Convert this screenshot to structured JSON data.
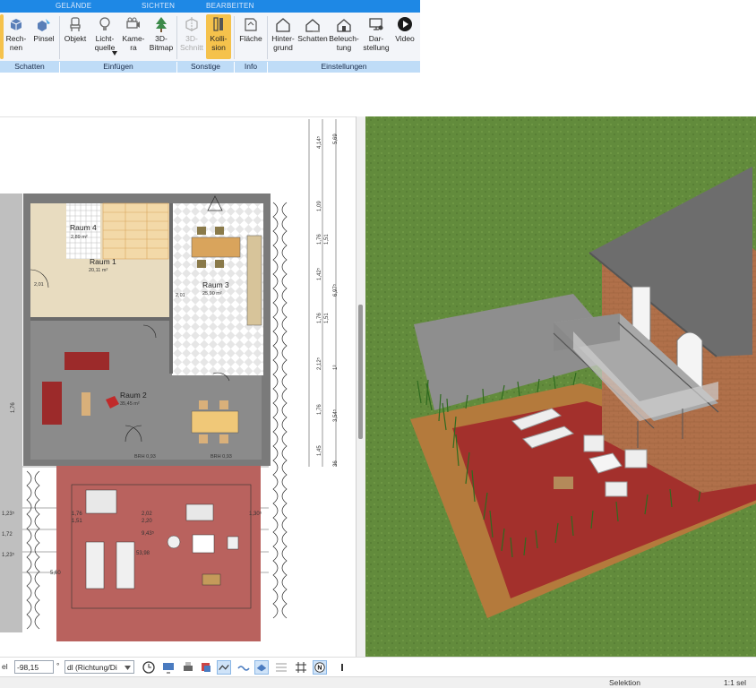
{
  "ribbon": {
    "tabs": [
      "GELÄNDE",
      "SICHTEN",
      "BEARBEITEN"
    ],
    "buttons": {
      "rechnen": "Rech-\nnen",
      "pinsel": "Pinsel",
      "objekt": "Objekt",
      "lichtquelle": "Licht-\nquelle",
      "kamera": "Kame-\nra",
      "bitmap": "3D-\nBitmap",
      "schnitt": "3D-\nSchnitt",
      "kollision": "Kolli-\nsion",
      "flaeche": "Fläche",
      "hintergrund": "Hinter-\ngrund",
      "schatten": "Schatten",
      "beleuchtung": "Beleuch-\ntung",
      "darstellung": "Dar-\nstellung",
      "video": "Video"
    },
    "groups": {
      "schatten": "Schatten",
      "einfuegen": "Einfügen",
      "sonstige": "Sonstige",
      "info": "Info",
      "einstellungen": "Einstellungen"
    }
  },
  "plan": {
    "rooms": [
      {
        "name": "Raum 4",
        "area": "2,89 m²"
      },
      {
        "name": "Raum 1",
        "area": "20,11 m²"
      },
      {
        "name": "Raum 3",
        "area": "25,90 m²"
      },
      {
        "name": "Raum 2",
        "area": "35,45 m²"
      }
    ],
    "dims_right": [
      "5,69",
      "4,14⁵",
      "1,09",
      "1,76",
      "1,51",
      "1,42⁵",
      "6,97⁵",
      "1,76",
      "1,51",
      "2,12⁵",
      "1³",
      "1,76",
      "3,54⁵",
      "1,45",
      "36"
    ],
    "dims_left": [
      "1,76",
      "1,23⁵",
      "1,72",
      "1,23⁵",
      "5,60"
    ],
    "dims_terrace": [
      "1,76",
      "1,51",
      "2,02",
      "2,20",
      "1,30⁵",
      "9,43⁵",
      "53,98"
    ],
    "small_labels": [
      "2,01",
      "2,01",
      "BRH 0,93",
      "BRH 0,93"
    ]
  },
  "toolbar": {
    "value_label": "el",
    "value": "-98,15",
    "unit": "°",
    "direction": "dl (Richtung/Di",
    "icons": [
      "clock-icon",
      "screen-icon",
      "print-icon",
      "paint-icon",
      "line-icon",
      "wave-icon",
      "plane-icon",
      "surface-icon",
      "hatch-icon",
      "grid-icon",
      "north-icon",
      "more-icon"
    ]
  },
  "status": {
    "selektion": "Selektion",
    "scale": "1:1 sel"
  },
  "colors": {
    "tab_blue": "#1e88e5",
    "group_blue": "#bfdcf7",
    "active_btn": "#f5c24c",
    "grass": "#5f8a3a",
    "terrace_red": "#9c3a35"
  }
}
